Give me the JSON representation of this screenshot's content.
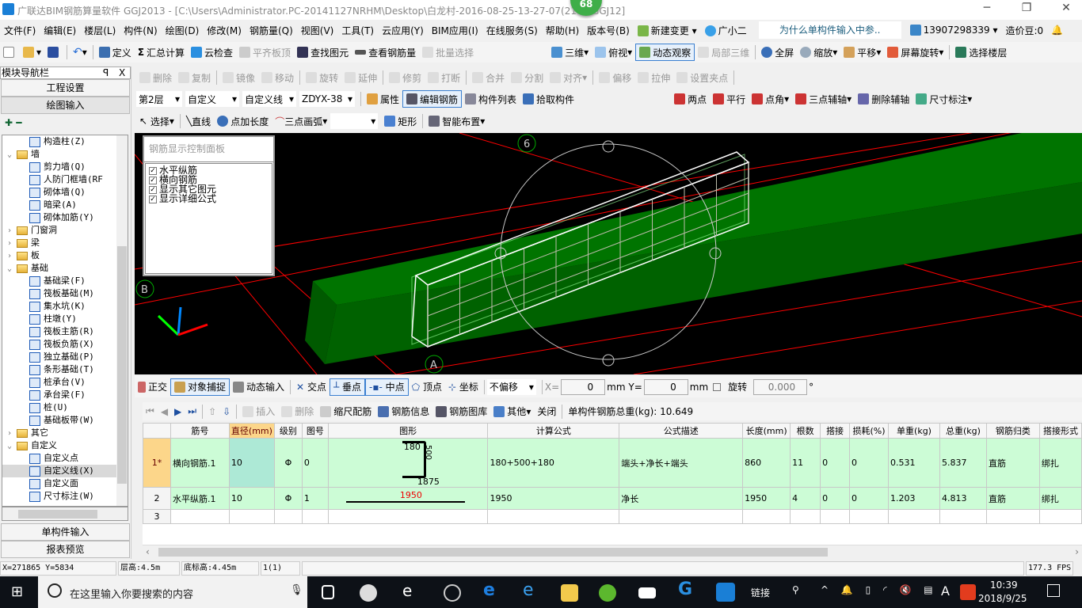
{
  "title": "广联达BIM钢筋算量软件 GGJ2013 - [C:\\Users\\Administrator.PC-20141127NRHM\\Desktop\\白龙村-2016-08-25-13-27-07(2186 GGJ12]",
  "badge": "68",
  "menu": [
    "文件(F)",
    "编辑(E)",
    "楼层(L)",
    "构件(N)",
    "绘图(D)",
    "修改(M)",
    "钢筋量(Q)",
    "视图(V)",
    "工具(T)",
    "云应用(Y)",
    "BIM应用(I)",
    "在线服务(S)",
    "帮助(H)",
    "版本号(B)",
    "新建变更",
    "广小二"
  ],
  "menu_right": {
    "question": "为什么单构件输入中参..",
    "account": "13907298339",
    "beans": "造价豆:0"
  },
  "toolbar1": [
    "定义",
    "汇总计算",
    "云检查",
    "平齐板顶",
    "查找图元",
    "查看钢筋量",
    "批量选择",
    "三维",
    "俯视",
    "动态观察",
    "局部三维",
    "全屏",
    "缩放",
    "平移",
    "屏幕旋转",
    "选择楼层"
  ],
  "toolbar2": [
    "删除",
    "复制",
    "镜像",
    "移动",
    "旋转",
    "延伸",
    "修剪",
    "打断",
    "合并",
    "分割",
    "对齐",
    "偏移",
    "拉伸",
    "设置夹点"
  ],
  "toolbar3": {
    "floor": "第2层",
    "type": "自定义",
    "sub": "自定义线",
    "name": "ZDYX-38",
    "buttons": [
      "属性",
      "编辑钢筋",
      "构件列表",
      "拾取构件"
    ],
    "axis": [
      "两点",
      "平行",
      "点角",
      "三点辅轴",
      "删除辅轴",
      "尺寸标注"
    ]
  },
  "toolbar4": [
    "选择",
    "直线",
    "点加长度",
    "三点画弧",
    "矩形",
    "智能布置"
  ],
  "nav": {
    "title": "模块导航栏",
    "pin": "ㅁ",
    "close": "X",
    "project": "工程设置",
    "drawing": "绘图输入",
    "single": "单构件输入",
    "report": "报表预览",
    "tree": [
      {
        "label": "构造柱(Z)",
        "t": "leaf",
        "l": 2
      },
      {
        "label": "墙",
        "t": "open",
        "l": 1
      },
      {
        "label": "剪力墙(Q)",
        "t": "leaf",
        "l": 2
      },
      {
        "label": "人防门框墙(RF",
        "t": "leaf",
        "l": 2
      },
      {
        "label": "砌体墙(Q)",
        "t": "leaf",
        "l": 2
      },
      {
        "label": "暗梁(A)",
        "t": "leaf",
        "l": 2
      },
      {
        "label": "砌体加筋(Y)",
        "t": "leaf",
        "l": 2
      },
      {
        "label": "门窗洞",
        "t": "closed",
        "l": 1
      },
      {
        "label": "梁",
        "t": "closed",
        "l": 1
      },
      {
        "label": "板",
        "t": "closed",
        "l": 1
      },
      {
        "label": "基础",
        "t": "open",
        "l": 1
      },
      {
        "label": "基础梁(F)",
        "t": "leaf",
        "l": 2
      },
      {
        "label": "筏板基础(M)",
        "t": "leaf",
        "l": 2
      },
      {
        "label": "集水坑(K)",
        "t": "leaf",
        "l": 2
      },
      {
        "label": "柱墩(Y)",
        "t": "leaf",
        "l": 2
      },
      {
        "label": "筏板主筋(R)",
        "t": "leaf",
        "l": 2
      },
      {
        "label": "筏板负筋(X)",
        "t": "leaf",
        "l": 2
      },
      {
        "label": "独立基础(P)",
        "t": "leaf",
        "l": 2
      },
      {
        "label": "条形基础(T)",
        "t": "leaf",
        "l": 2
      },
      {
        "label": "桩承台(V)",
        "t": "leaf",
        "l": 2
      },
      {
        "label": "承台梁(F)",
        "t": "leaf",
        "l": 2
      },
      {
        "label": "桩(U)",
        "t": "leaf",
        "l": 2
      },
      {
        "label": "基础板带(W)",
        "t": "leaf",
        "l": 2
      },
      {
        "label": "其它",
        "t": "closed",
        "l": 1
      },
      {
        "label": "自定义",
        "t": "open",
        "l": 1
      },
      {
        "label": "自定义点",
        "t": "leaf",
        "l": 2
      },
      {
        "label": "自定义线(X)",
        "t": "leaf",
        "l": 2,
        "selected": true
      },
      {
        "label": "自定义面",
        "t": "leaf",
        "l": 2
      },
      {
        "label": "尺寸标注(W)",
        "t": "leaf",
        "l": 2
      }
    ]
  },
  "rebar_panel": {
    "title": "钢筋显示控制面板",
    "items": [
      "水平纵筋",
      "横向钢筋",
      "显示其它图元",
      "显示详细公式"
    ]
  },
  "viewport": {
    "axis_labels": [
      "6",
      "B",
      "A"
    ],
    "colors": {
      "beam": "#007a00",
      "grid": "#ff0000",
      "cage": "#ffffff"
    }
  },
  "snapbar": {
    "buttons": [
      "正交",
      "对象捕捉",
      "动态输入",
      "交点",
      "垂点",
      "中点",
      "顶点",
      "坐标"
    ],
    "offset": "不偏移",
    "x_label": "X=",
    "x": "0",
    "y_label": "Y=",
    "y": "0",
    "unit": "mm",
    "rotate": "旋转",
    "angle": "0.000",
    "deg": "°"
  },
  "table_toolbar": {
    "buttons": [
      "插入",
      "删除",
      "缩尺配筋",
      "钢筋信息",
      "钢筋图库",
      "其他",
      "关闭"
    ],
    "total": "单构件钢筋总重(kg): 10.649"
  },
  "table": {
    "headers": [
      "",
      "筋号",
      "直径(mm)",
      "级别",
      "图号",
      "图形",
      "计算公式",
      "公式描述",
      "长度(mm)",
      "根数",
      "搭接",
      "损耗(%)",
      "单重(kg)",
      "总重(kg)",
      "钢筋归类",
      "搭接形式"
    ],
    "rows": [
      {
        "idx": "1*",
        "name": "横向钢筋.1",
        "dia": "10",
        "grade": "Φ",
        "fig": "0",
        "shape": {
          "top": "180",
          "mid": "500",
          "bottom": "1875"
        },
        "formula": "180+500+180",
        "desc": "端头+净长+端头",
        "len": "860",
        "count": "11",
        "lap": "0",
        "loss": "0",
        "unit_w": "0.531",
        "total_w": "5.837",
        "cat": "直筋",
        "lap_type": "绑扎"
      },
      {
        "idx": "2",
        "name": "水平纵筋.1",
        "dia": "10",
        "grade": "Φ",
        "fig": "1",
        "shape": {
          "len": "1950"
        },
        "formula": "1950",
        "desc": "净长",
        "len": "1950",
        "count": "4",
        "lap": "0",
        "loss": "0",
        "unit_w": "1.203",
        "total_w": "4.813",
        "cat": "直筋",
        "lap_type": "绑扎"
      },
      {
        "idx": "3"
      }
    ]
  },
  "status": {
    "coords": "X=271865 Y=5834",
    "floor_h": "层高:4.5m",
    "base_h": "底标高:4.45m",
    "count": "1(1)",
    "fps": "177.3 FPS"
  },
  "taskbar": {
    "search": "在这里输入你要搜索的内容",
    "link": "链接",
    "time": "10:39",
    "date": "2018/9/25",
    "ime": "A"
  }
}
